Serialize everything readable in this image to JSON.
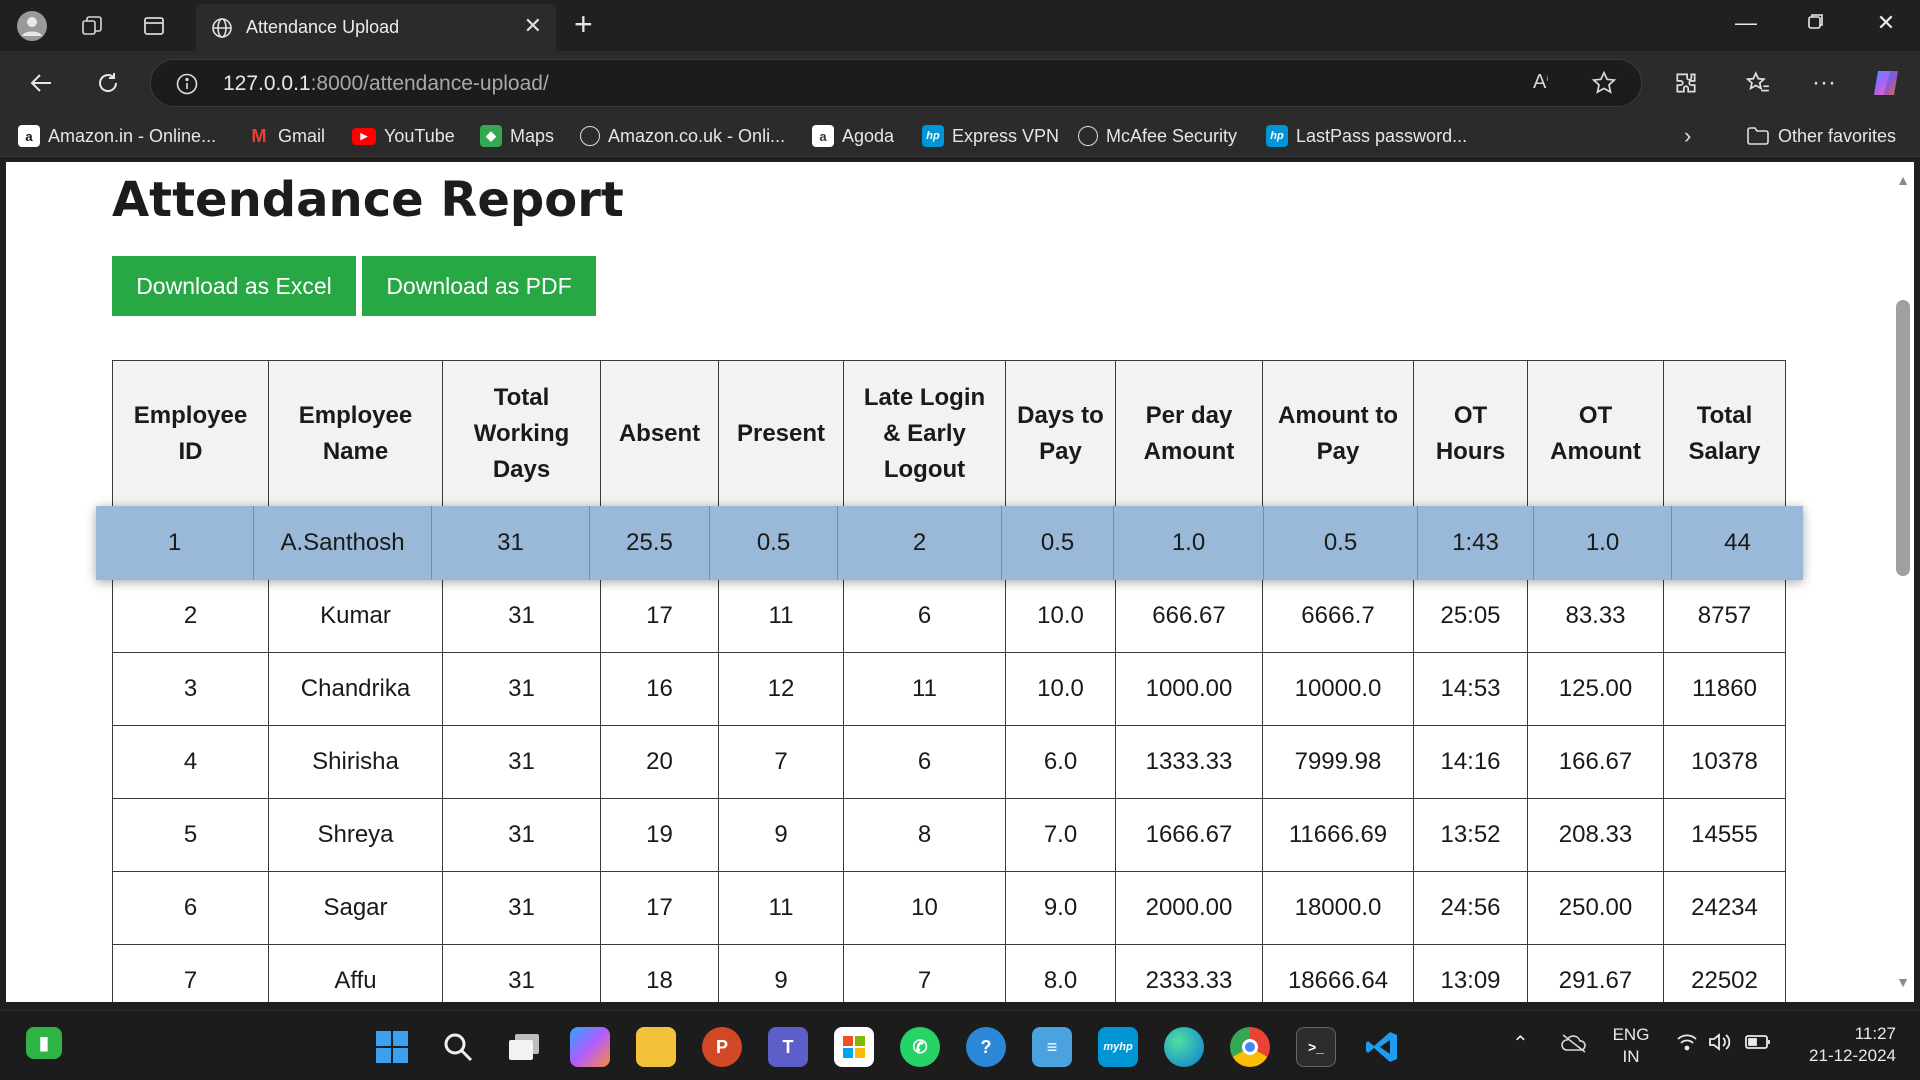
{
  "browser": {
    "tab_title": "Attendance Upload",
    "url_host": "127.0.0.1",
    "url_rest": ":8000/attendance-upload/",
    "favorites": [
      {
        "label": "Amazon.in - Online...",
        "icon": "amazon-icon",
        "color": "#ffffff"
      },
      {
        "label": "Gmail",
        "icon": "gmail-icon",
        "color": "#ea4335"
      },
      {
        "label": "YouTube",
        "icon": "youtube-icon",
        "color": "#ff0000"
      },
      {
        "label": "Maps",
        "icon": "maps-icon",
        "color": "#34a853"
      },
      {
        "label": "Amazon.co.uk - Onli...",
        "icon": "globe-icon",
        "color": "#2b2b2b"
      },
      {
        "label": "Agoda",
        "icon": "agoda-icon",
        "color": "#ffffff"
      },
      {
        "label": "Express VPN",
        "icon": "hp-icon",
        "color": "#0096d6"
      },
      {
        "label": "McAfee Security",
        "icon": "globe-icon",
        "color": "#2b2b2b"
      },
      {
        "label": "LastPass password...",
        "icon": "hp-icon",
        "color": "#0096d6"
      }
    ],
    "other_favorites": "Other favorites"
  },
  "page": {
    "title": "Attendance Report",
    "btn_excel": "Download as Excel",
    "btn_pdf": "Download as PDF",
    "columns": [
      "Employee ID",
      "Employee Name",
      "Total Working Days",
      "Absent",
      "Present",
      "Late Login & Early Logout",
      "Days to Pay",
      "Per day Amount",
      "Amount to Pay",
      "OT Hours",
      "OT Amount",
      "Total Salary"
    ],
    "highlighted_row": [
      "1",
      "A.Santhosh",
      "31",
      "25.5",
      "0.5",
      "2",
      "0.5",
      "1.0",
      "0.5",
      "1:43",
      "1.0",
      "44"
    ],
    "rows": [
      [
        "2",
        "Kumar",
        "31",
        "17",
        "11",
        "6",
        "10.0",
        "666.67",
        "6666.7",
        "25:05",
        "83.33",
        "8757"
      ],
      [
        "3",
        "Chandrika",
        "31",
        "16",
        "12",
        "11",
        "10.0",
        "1000.00",
        "10000.0",
        "14:53",
        "125.00",
        "11860"
      ],
      [
        "4",
        "Shirisha",
        "31",
        "20",
        "7",
        "6",
        "6.0",
        "1333.33",
        "7999.98",
        "14:16",
        "166.67",
        "10378"
      ],
      [
        "5",
        "Shreya",
        "31",
        "19",
        "9",
        "8",
        "7.0",
        "1666.67",
        "11666.69",
        "13:52",
        "208.33",
        "14555"
      ],
      [
        "6",
        "Sagar",
        "31",
        "17",
        "11",
        "10",
        "9.0",
        "2000.00",
        "18000.0",
        "24:56",
        "250.00",
        "24234"
      ],
      [
        "7",
        "Affu",
        "31",
        "18",
        "9",
        "7",
        "8.0",
        "2333.33",
        "18666.64",
        "13:09",
        "291.67",
        "22502"
      ]
    ]
  },
  "taskbar": {
    "lang_top": "ENG",
    "lang_bottom": "IN",
    "time": "11:27",
    "date": "21-12-2024",
    "icons": [
      "windows-start-icon",
      "search-icon",
      "task-view-icon",
      "copilot-icon",
      "file-explorer-icon",
      "powerpoint-icon",
      "teams-icon",
      "store-icon",
      "whatsapp-icon",
      "help-icon",
      "notepad-icon",
      "myhp-icon",
      "edge-icon",
      "chrome-icon",
      "terminal-icon",
      "vscode-icon"
    ]
  }
}
